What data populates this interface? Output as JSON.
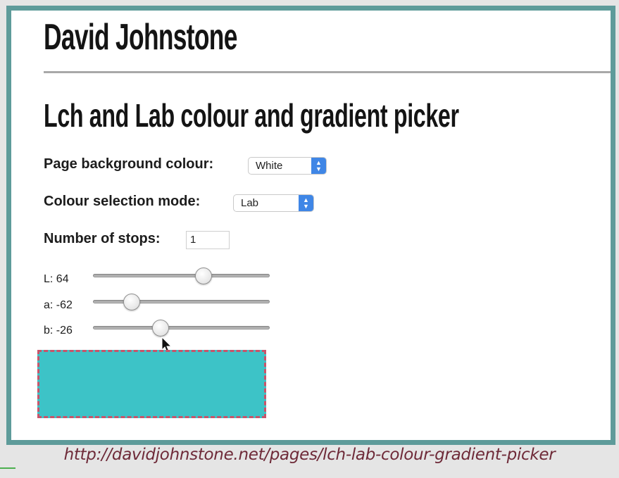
{
  "site": {
    "title": "David Johnstone"
  },
  "page": {
    "heading": "Lch and Lab colour and gradient picker"
  },
  "background_row": {
    "label": "Page background colour:",
    "selected": "White"
  },
  "mode_row": {
    "label": "Colour selection mode:",
    "selected": "Lab"
  },
  "stops_row": {
    "label": "Number of stops:",
    "value": "1"
  },
  "sliders": [
    {
      "label": "L: 64",
      "value": 64,
      "min": 0,
      "max": 100
    },
    {
      "label": "a: -62",
      "value": -62,
      "min": -100,
      "max": 100
    },
    {
      "label": "b: -26",
      "value": -26,
      "min": -100,
      "max": 100
    }
  ],
  "swatch": {
    "color": "#3dc3c7",
    "border_color": "#c9546a"
  },
  "caption": {
    "url_text": "http://davidjohnstone.net/pages/lch-lab-colour-gradient-picker"
  },
  "colors": {
    "frame": "#5e9b9a",
    "select_accent": "#3f86e6"
  },
  "icons": {
    "cursor": "arrow-cursor-icon",
    "select_arrows": "chevron-updown-icon"
  }
}
